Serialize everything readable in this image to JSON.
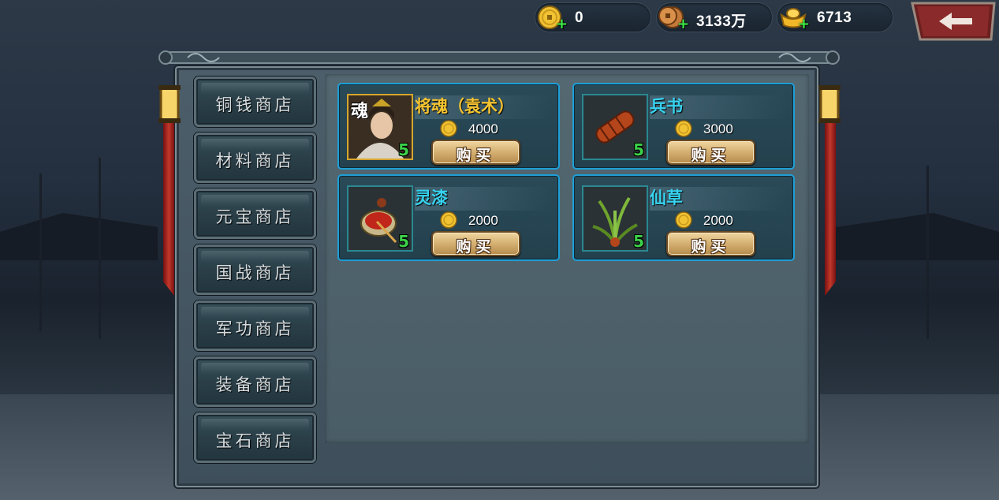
{
  "currencies": [
    {
      "icon": "gold-coin-icon",
      "value": "0"
    },
    {
      "icon": "copper-coin-icon",
      "value": "3133万"
    },
    {
      "icon": "gold-ingot-icon",
      "value": "6713"
    }
  ],
  "shops": [
    {
      "label": "铜钱商店"
    },
    {
      "label": "材料商店"
    },
    {
      "label": "元宝商店"
    },
    {
      "label": "国战商店"
    },
    {
      "label": "军功商店"
    },
    {
      "label": "装备商店"
    },
    {
      "label": "宝石商店"
    }
  ],
  "items": [
    {
      "name": "将魂（袁术）",
      "price": "4000",
      "level": "5",
      "badge": "魂",
      "name_color": "#f5c431",
      "buy_label": "购买"
    },
    {
      "name": "兵书",
      "price": "3000",
      "level": "5",
      "name_color": "#37d3f0",
      "buy_label": "购买"
    },
    {
      "name": "灵漆",
      "price": "2000",
      "level": "5",
      "name_color": "#37d3f0",
      "buy_label": "购买"
    },
    {
      "name": "仙草",
      "price": "2000",
      "level": "5",
      "name_color": "#37d3f0",
      "buy_label": "购买"
    }
  ],
  "colors": {
    "card_border": "#1f9fd6",
    "plus": "#3ef04a",
    "level": "#3cd14a"
  }
}
